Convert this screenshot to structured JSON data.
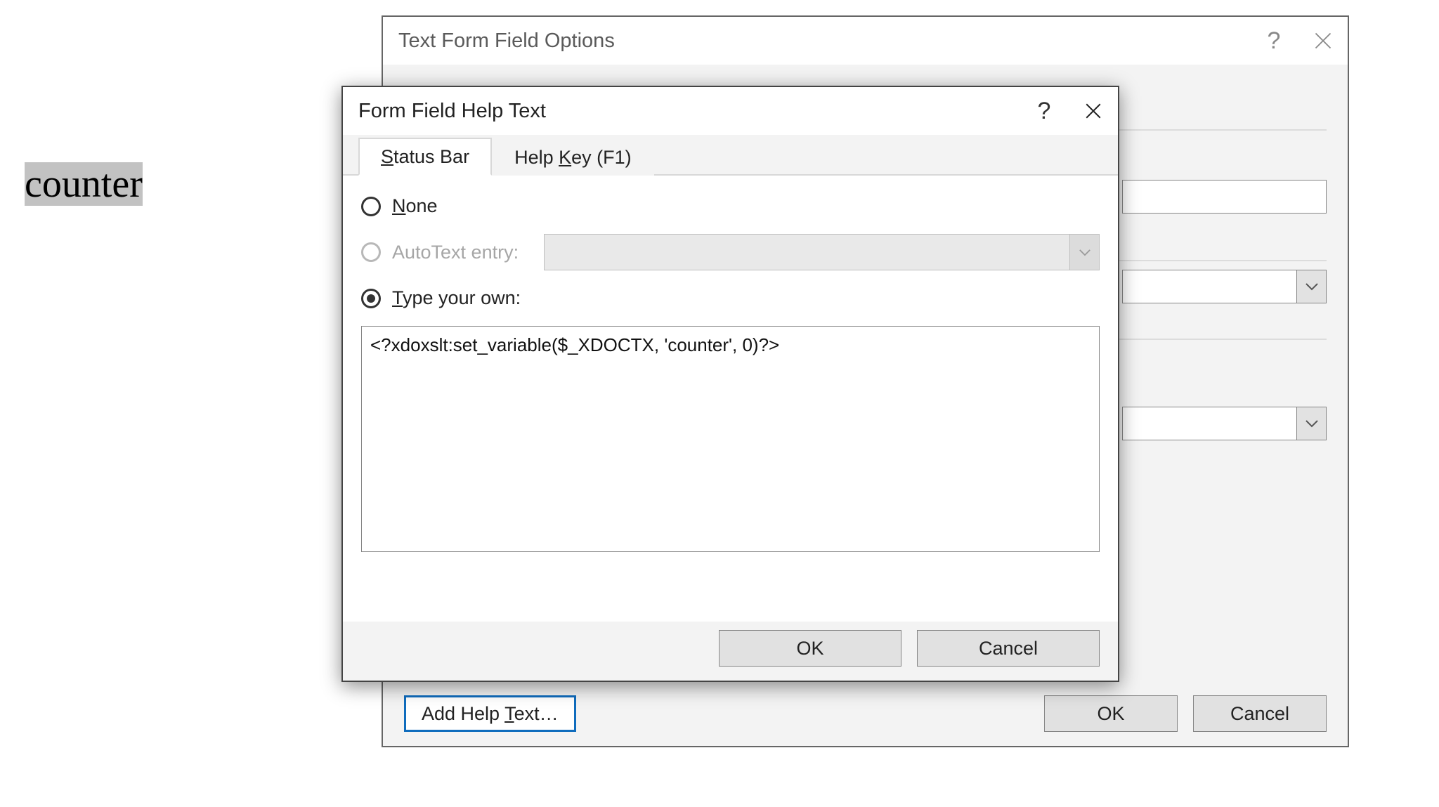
{
  "document": {
    "highlighted_text": "counter"
  },
  "backDialog": {
    "title": "Text Form Field Options",
    "addHelpText": "Add Help Text…",
    "ok": "OK",
    "cancel": "Cancel"
  },
  "frontDialog": {
    "title": "Form Field Help Text",
    "tabs": {
      "statusBar": "Status Bar",
      "helpKey": "Help Key (F1)"
    },
    "radios": {
      "none": "None",
      "autotext": "AutoText entry:",
      "typeOwn": "Type your own:"
    },
    "typeOwnValue": "<?xdoxslt:set_variable($_XDOCTX, 'counter', 0)?>",
    "ok": "OK",
    "cancel": "Cancel"
  }
}
